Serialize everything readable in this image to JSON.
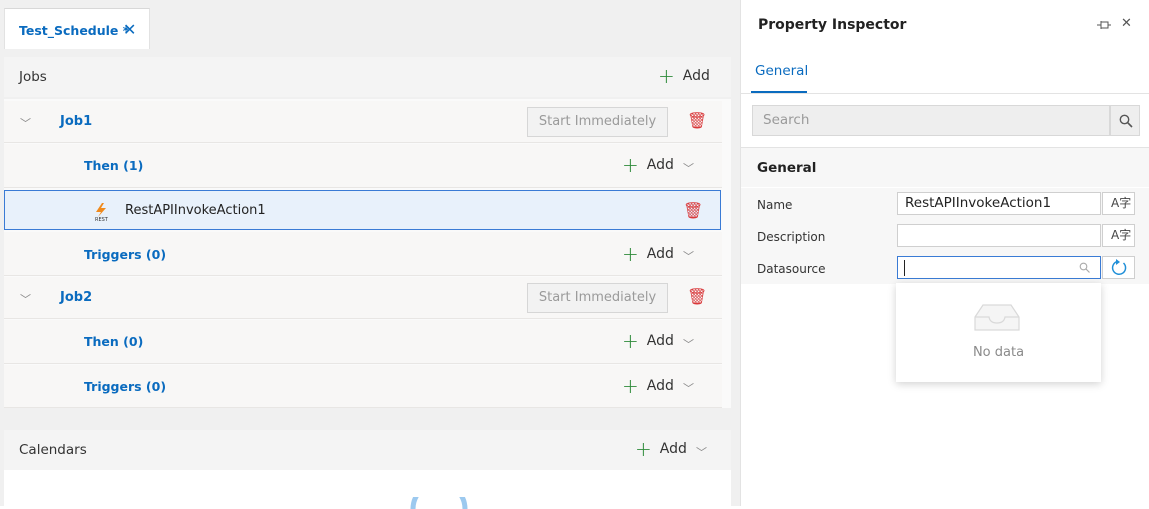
{
  "tab": {
    "title": "Test_Schedule *"
  },
  "jobs": {
    "title": "Jobs",
    "add_label": "Add",
    "items": [
      {
        "name": "Job1",
        "start_label": "Start Immediately",
        "then": {
          "label": "Then (1)",
          "add_label": "Add",
          "actions": [
            {
              "name": "RestAPIInvokeAction1",
              "icon": "rest-api-icon"
            }
          ]
        },
        "triggers": {
          "label": "Triggers (0)",
          "add_label": "Add"
        }
      },
      {
        "name": "Job2",
        "start_label": "Start Immediately",
        "then": {
          "label": "Then (0)",
          "add_label": "Add"
        },
        "triggers": {
          "label": "Triggers (0)",
          "add_label": "Add"
        }
      }
    ]
  },
  "calendars": {
    "title": "Calendars",
    "add_label": "Add"
  },
  "inspector": {
    "title": "Property Inspector",
    "tab": "General",
    "search_placeholder": "Search",
    "section": "General",
    "fields": {
      "name": {
        "label": "Name",
        "value": "RestAPIInvokeAction1"
      },
      "description": {
        "label": "Description",
        "value": ""
      },
      "datasource": {
        "label": "Datasource",
        "value": ""
      }
    },
    "dropdown_empty": "No data"
  },
  "colors": {
    "accent": "#0a6bbf",
    "add": "#2e8b3a",
    "delete": "#d9383a",
    "selection_border": "#3a7bd5"
  }
}
